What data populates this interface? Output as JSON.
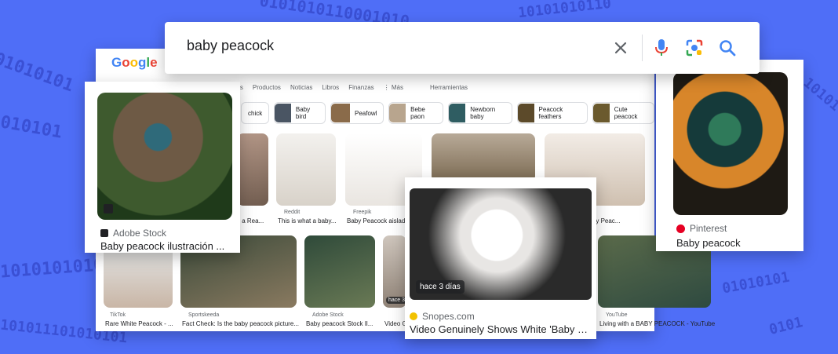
{
  "search": {
    "query": "baby peacock"
  },
  "google": {
    "logo": "Google",
    "tabs": [
      "eos",
      "Productos",
      "Noticias",
      "Libros",
      "Finanzas",
      "⋮ Más",
      "Herramientas"
    ],
    "chips": [
      "chick",
      "Baby bird",
      "Peafowl",
      "Bebe paon",
      "Newborn baby",
      "Peacock feathers",
      "Cute peacock"
    ]
  },
  "grid": {
    "row1": [
      {
        "source": "",
        "caption": "s a Rea..."
      },
      {
        "source": "Reddit",
        "caption": "This is what a baby..."
      },
      {
        "source": "Freepik",
        "caption": "Baby Peacock aislado"
      },
      {
        "source": "",
        "caption": "f a Baby Peac..."
      }
    ],
    "row2": [
      {
        "source": "TikTok",
        "caption": "Rare White Peacock - ..."
      },
      {
        "source": "Sportskeeda",
        "caption": "Fact Check: Is the baby peacock picture..."
      },
      {
        "source": "Adobe Stock",
        "caption": "Baby peacock Stock Il..."
      },
      {
        "source": "",
        "caption": "Video G"
      },
      {
        "source": "YouTube",
        "caption": "Living with a BABY PEACOCK - YouTube"
      }
    ]
  },
  "cards": {
    "left": {
      "source": "Adobe Stock",
      "title": "Baby peacock ilustración ..."
    },
    "center": {
      "badge": "hace 3 días",
      "source": "Snopes.com",
      "title": "Video Genuinely Shows White 'Baby Pe..."
    },
    "center_small_badge": "hace 3",
    "right": {
      "source": "Pinterest",
      "title": "Baby peacock"
    }
  },
  "colors": {
    "background": "#4f6ef7",
    "binary": "#3346c9",
    "google_blue": "#4285f4",
    "google_red": "#ea4335"
  }
}
